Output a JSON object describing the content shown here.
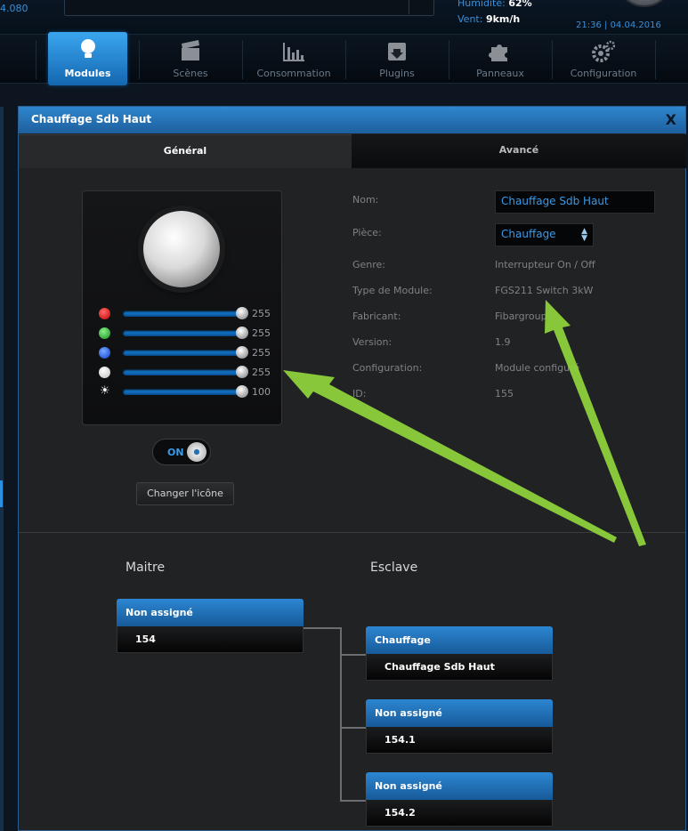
{
  "header": {
    "version": "4.080",
    "humidity_label": "Humidité:",
    "humidity_value": "62%",
    "wind_label": "Vent:",
    "wind_value": "9km/h",
    "time": "21:36",
    "date": "04.04.2016"
  },
  "nav": {
    "items": [
      {
        "label": "Modules",
        "icon": "bulb-icon",
        "active": true
      },
      {
        "label": "Scènes",
        "icon": "clapper-icon"
      },
      {
        "label": "Consommation",
        "icon": "bar-chart-icon"
      },
      {
        "label": "Plugins",
        "icon": "download-box-icon"
      },
      {
        "label": "Panneaux",
        "icon": "puzzle-icon"
      },
      {
        "label": "Configuration",
        "icon": "gears-icon"
      }
    ]
  },
  "dialog": {
    "title": "Chauffage Sdb Haut",
    "close": "X",
    "tabs": {
      "general": "Général",
      "advanced": "Avancé"
    },
    "sliders": [
      {
        "color": "#e01010",
        "value": "255"
      },
      {
        "color": "#2ab030",
        "value": "255"
      },
      {
        "color": "#1a5ff0",
        "value": "255"
      },
      {
        "color": "#ffffff",
        "value": "255"
      },
      {
        "color": "sun",
        "value": "100"
      }
    ],
    "toggle_label": "ON",
    "change_icon_label": "Changer l'icône",
    "fields": {
      "name_label": "Nom:",
      "name_value": "Chauffage Sdb Haut",
      "room_label": "Pièce:",
      "room_value": "Chauffage",
      "genre_label": "Genre:",
      "genre_value": "Interrupteur On / Off",
      "type_label": "Type de Module:",
      "type_value": "FGS211 Switch 3kW",
      "maker_label": "Fabricant:",
      "maker_value": "Fibargroup",
      "version_label": "Version:",
      "version_value": "1.9",
      "config_label": "Configuration:",
      "config_value": "Module configuré",
      "id_label": "ID:",
      "id_value": "155"
    },
    "master": {
      "title": "Maitre",
      "header": "Non assigné",
      "value": "154"
    },
    "slave": {
      "title": "Esclave",
      "nodes": [
        {
          "header": "Chauffage",
          "value": "Chauffage Sdb Haut"
        },
        {
          "header": "Non assigné",
          "value": "154.1"
        },
        {
          "header": "Non assigné",
          "value": "154.2"
        }
      ]
    }
  }
}
